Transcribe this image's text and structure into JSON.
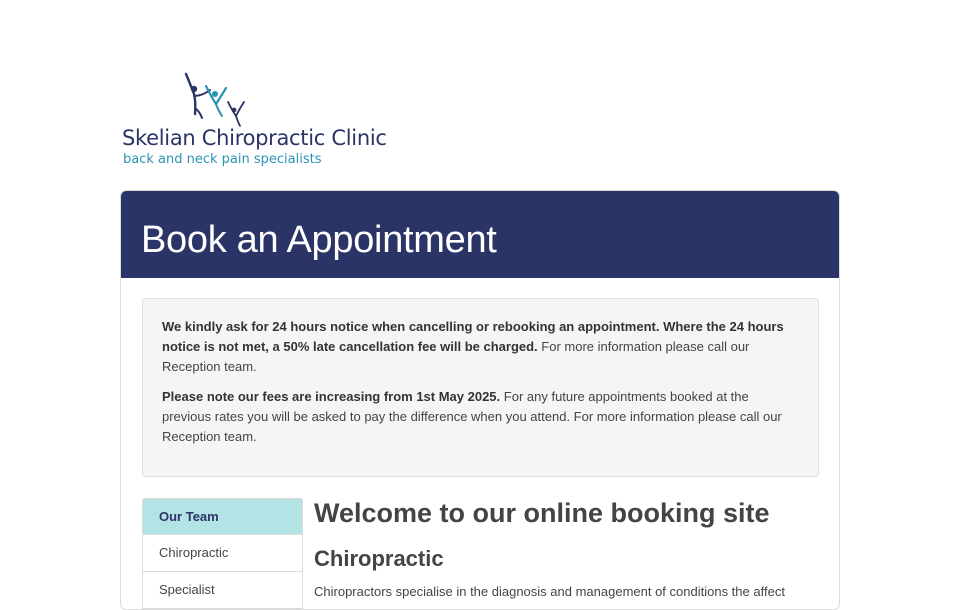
{
  "logo": {
    "clinic_name": "Skelian Chiropractic Clinic",
    "tagline": "back and neck pain specialists",
    "colors": {
      "navy": "#2b3466",
      "teal": "#2b93b5"
    }
  },
  "header": {
    "title": "Book an Appointment",
    "bg_color": "#2b3466"
  },
  "notice": {
    "p1_bold": "We kindly ask for 24 hours notice when cancelling or rebooking an appointment. Where the 24 hours notice is not met, a 50% late cancellation fee will be charged.",
    "p1_text": " For more information please call our Reception team.",
    "p2_bold": "Please note our fees are increasing from 1st May 2025.",
    "p2_text": " For any future appointments booked at the previous rates you will be asked to pay the difference when you attend. For more information please call our Reception team."
  },
  "side_nav": {
    "items": [
      {
        "label": "Our Team",
        "active": true
      },
      {
        "label": "Chiropractic",
        "active": false
      },
      {
        "label": "Specialist",
        "active": false
      }
    ]
  },
  "main": {
    "welcome": "Welcome to our online booking site",
    "section_title": "Chiropractic",
    "section_text": "Chiropractors specialise in the diagnosis and management of conditions the affect"
  },
  "colors": {
    "active_nav": "#b3e3e4"
  }
}
